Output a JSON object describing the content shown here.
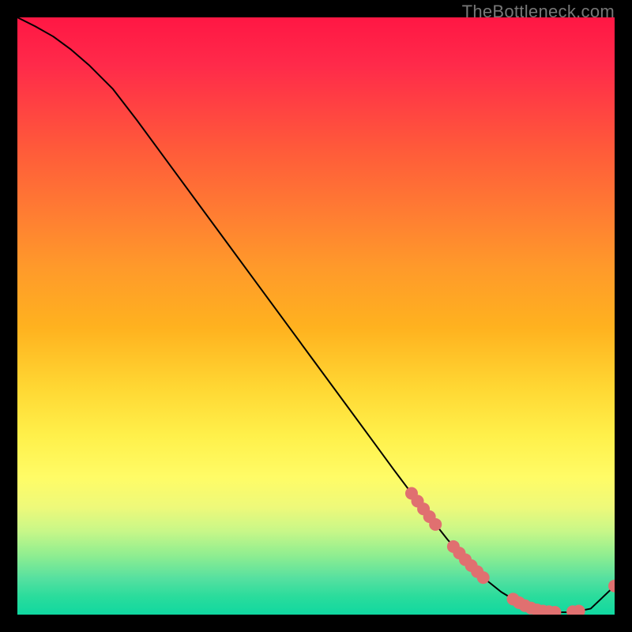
{
  "attribution": "TheBottleneck.com",
  "chart_data": {
    "type": "line",
    "title": "",
    "xlabel": "",
    "ylabel": "",
    "xlim": [
      0,
      100
    ],
    "ylim": [
      0,
      100
    ],
    "grid": false,
    "background": "rainbow-vertical-gradient",
    "series": [
      {
        "name": "curve",
        "color": "#000000",
        "x": [
          0,
          3,
          6,
          9,
          12,
          16,
          20,
          25,
          30,
          35,
          40,
          45,
          50,
          55,
          60,
          63,
          66,
          69,
          72,
          75,
          78,
          81,
          84,
          86,
          88,
          90,
          92,
          94,
          96,
          100
        ],
        "y": [
          100,
          98.5,
          96.8,
          94.6,
          92.0,
          88.0,
          82.8,
          76.0,
          69.2,
          62.4,
          55.6,
          48.8,
          42.0,
          35.2,
          28.4,
          24.3,
          20.3,
          16.4,
          12.6,
          9.2,
          6.2,
          3.8,
          2.0,
          1.1,
          0.6,
          0.4,
          0.4,
          0.6,
          1.0,
          4.8
        ]
      }
    ],
    "markers": [
      {
        "x": 66.0,
        "y": 20.3
      },
      {
        "x": 67.0,
        "y": 19.0
      },
      {
        "x": 68.0,
        "y": 17.7
      },
      {
        "x": 69.0,
        "y": 16.4
      },
      {
        "x": 70.0,
        "y": 15.1
      },
      {
        "x": 73.0,
        "y": 11.4
      },
      {
        "x": 74.0,
        "y": 10.3
      },
      {
        "x": 75.0,
        "y": 9.2
      },
      {
        "x": 76.0,
        "y": 8.2
      },
      {
        "x": 77.0,
        "y": 7.2
      },
      {
        "x": 78.0,
        "y": 6.2
      },
      {
        "x": 83.0,
        "y": 2.6
      },
      {
        "x": 84.0,
        "y": 2.0
      },
      {
        "x": 85.0,
        "y": 1.5
      },
      {
        "x": 86.0,
        "y": 1.1
      },
      {
        "x": 87.0,
        "y": 0.8
      },
      {
        "x": 88.0,
        "y": 0.6
      },
      {
        "x": 89.0,
        "y": 0.5
      },
      {
        "x": 90.0,
        "y": 0.4
      },
      {
        "x": 93.0,
        "y": 0.5
      },
      {
        "x": 94.0,
        "y": 0.6
      },
      {
        "x": 100.0,
        "y": 4.8
      }
    ],
    "marker_color": "#e07070",
    "marker_radius": 8
  }
}
